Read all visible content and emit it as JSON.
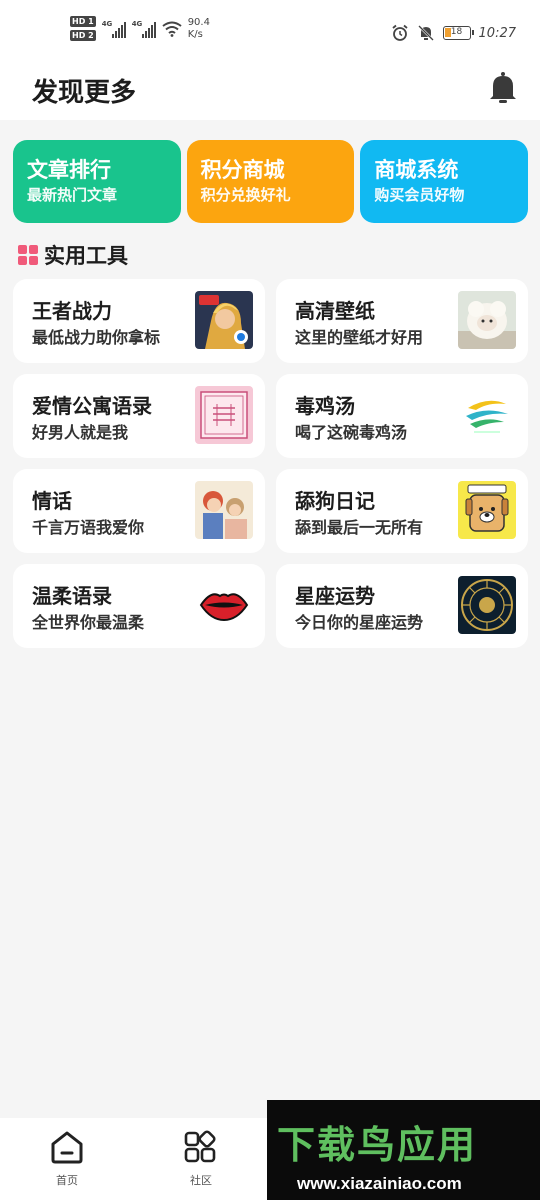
{
  "status_bar": {
    "sim1": "HD 1",
    "sim2": "HD 2",
    "net1": "4G",
    "net2": "4G",
    "speed_value": "90.4",
    "speed_unit": "K/s",
    "battery": "18",
    "time": "10:27"
  },
  "header": {
    "title": "发现更多",
    "icon": "bell-icon"
  },
  "top_cards": [
    {
      "title": "文章排行",
      "subtitle": "最新热门文章",
      "color": "#19c48d"
    },
    {
      "title": "积分商城",
      "subtitle": "积分兑换好礼",
      "color": "#fca50f"
    },
    {
      "title": "商城系统",
      "subtitle": "购买会员好物",
      "color": "#11b9f2"
    }
  ],
  "section": {
    "title": "实用工具",
    "icon": "grid-icon",
    "icon_color": "#f05a7a"
  },
  "tools": [
    {
      "title": "王者战力",
      "subtitle": "最低战力助你拿标",
      "icon": "game-hero-icon"
    },
    {
      "title": "高清壁纸",
      "subtitle": "这里的壁纸才好用",
      "icon": "sheep-plush-icon"
    },
    {
      "title": "爱情公寓语录",
      "subtitle": "好男人就是我",
      "icon": "love-apartment-icon"
    },
    {
      "title": "毒鸡汤",
      "subtitle": "喝了这碗毒鸡汤",
      "icon": "swirl-logo-icon"
    },
    {
      "title": "情话",
      "subtitle": "千言万语我爱你",
      "icon": "couple-illustration-icon"
    },
    {
      "title": "舔狗日记",
      "subtitle": "舔到最后一无所有",
      "icon": "dog-cartoon-icon"
    },
    {
      "title": "温柔语录",
      "subtitle": "全世界你最温柔",
      "icon": "lips-icon"
    },
    {
      "title": "星座运势",
      "subtitle": "今日你的星座运势",
      "icon": "zodiac-wheel-icon"
    }
  ],
  "bottom_nav": [
    {
      "label": "首页",
      "icon": "home-icon"
    },
    {
      "label": "社区",
      "icon": "apps-icon"
    }
  ],
  "watermark": {
    "main": "下载鸟应用",
    "url": "www.xiazainiao.com"
  }
}
